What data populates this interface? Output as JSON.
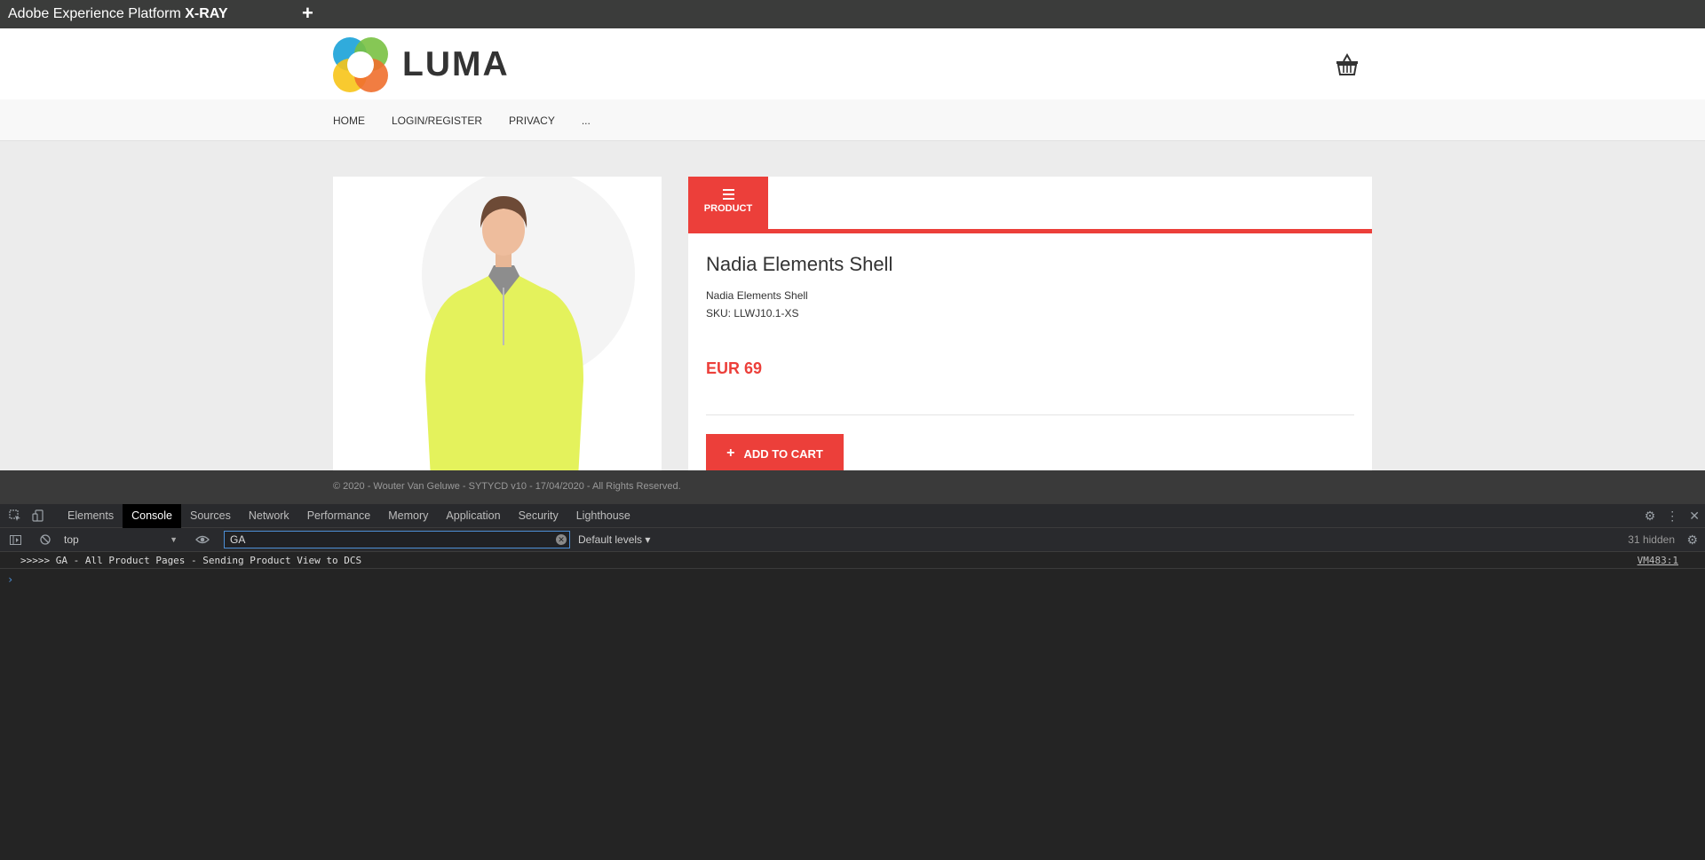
{
  "xray": {
    "title_prefix": "Adobe Experience Platform ",
    "title_bold": "X-RAY",
    "plus_label": "+"
  },
  "site": {
    "logo_text": "LUMA",
    "nav": [
      "HOME",
      "LOGIN/REGISTER",
      "PRIVACY",
      "..."
    ],
    "tab_label": "PRODUCT",
    "product_name": "Nadia Elements Shell",
    "product_subname": "Nadia Elements Shell",
    "product_sku": "SKU: LLWJ10.1-XS",
    "product_price": "EUR 69",
    "add_to_cart": "ADD TO CART",
    "footer": "© 2020 - Wouter Van Geluwe - SYTYCD v10 - 17/04/2020 - All Rights Reserved.",
    "colors": {
      "accent": "#ec3f3a",
      "shirt": "#e4f25c"
    }
  },
  "devtools": {
    "tabs": [
      "Elements",
      "Console",
      "Sources",
      "Network",
      "Performance",
      "Memory",
      "Application",
      "Security",
      "Lighthouse"
    ],
    "active_tab": "Console",
    "context": "top",
    "filter_value": "GA",
    "levels": "Default levels ▾",
    "hidden": "31 hidden",
    "log_message": ">>>>> GA - All Product Pages - Sending Product View to DCS",
    "log_source": "VM483:1",
    "prompt": "›"
  }
}
